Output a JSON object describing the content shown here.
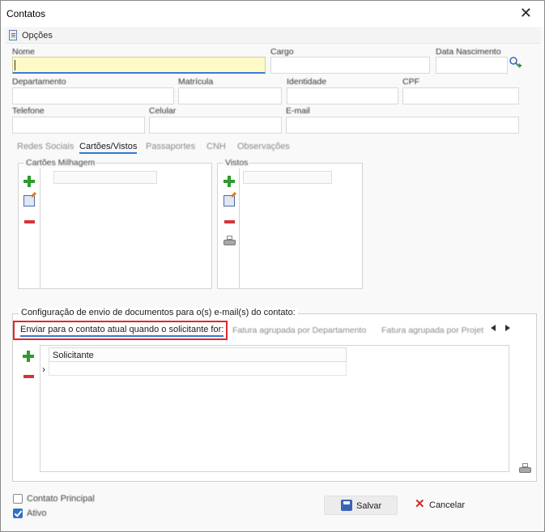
{
  "window": {
    "title": "Contatos"
  },
  "menubar": {
    "options_label": "Opções"
  },
  "form": {
    "nome_label": "Nome",
    "cargo_label": "Cargo",
    "data_nascimento_label": "Data Nascimento",
    "departamento_label": "Departamento",
    "matricula_label": "Matrícula",
    "identidade_label": "Identidade",
    "cpf_label": "CPF",
    "telefone_label": "Telefone",
    "celular_label": "Celular",
    "email_label": "E-mail"
  },
  "tabs": [
    "Redes Sociais",
    "Cartões/Vistos",
    "Passaportes",
    "CNH",
    "Observações"
  ],
  "cartoes": {
    "title": "Cartões Milhagem"
  },
  "vistos": {
    "title": "Vistos"
  },
  "config": {
    "title": "Configuração de envio de documentos para o(s) e-mail(s) do contato:",
    "tabs": [
      "Enviar para o contato atual quando o solicitante for:",
      "Fatura agrupada por Departamento",
      "Fatura agrupada por Projet"
    ],
    "grid_header": "Solicitante"
  },
  "footer": {
    "contato_principal_label": "Contato Principal",
    "contato_principal_checked": false,
    "ativo_label": "Ativo",
    "ativo_checked": true,
    "save_label": "Salvar",
    "cancel_label": "Cancelar"
  },
  "icons": {
    "add": "plus-icon",
    "edit": "edit-icon",
    "remove": "minus-icon",
    "print": "printer-icon",
    "save": "floppy-icon",
    "cancel": "x-icon",
    "close": "close-icon"
  },
  "colors": {
    "active_field_bg": "#fff9c8",
    "accent": "#2f7ad4",
    "highlight_border": "#e3262b",
    "add_green": "#2e9a2e",
    "remove_red": "#d73333"
  }
}
